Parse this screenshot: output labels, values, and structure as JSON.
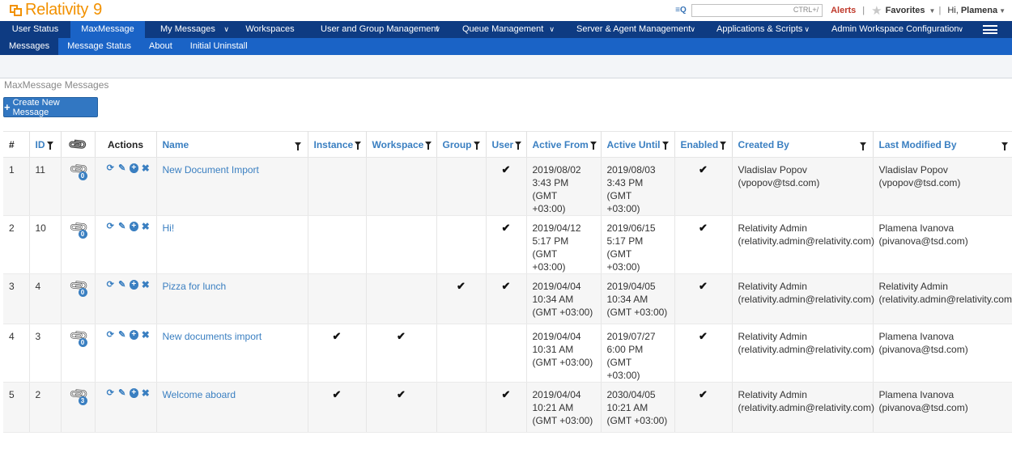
{
  "header": {
    "logo_text": "Relativity",
    "logo_version": "9",
    "search_shortcut": "CTRL+/",
    "alerts": "Alerts",
    "favorites": "Favorites",
    "greeting": "Hi,",
    "user": "Plamena"
  },
  "main_nav": [
    {
      "label": "User Status"
    },
    {
      "label": "MaxMessage"
    },
    {
      "label": "My Messages"
    },
    {
      "label": "Workspaces"
    },
    {
      "label": "User and Group Management"
    },
    {
      "label": "Queue Management"
    },
    {
      "label": "Server & Agent Management"
    },
    {
      "label": "Applications & Scripts"
    },
    {
      "label": "Admin Workspace Configuration"
    }
  ],
  "sub_nav": [
    {
      "label": "Messages"
    },
    {
      "label": "Message Status"
    },
    {
      "label": "About"
    },
    {
      "label": "Initial Uninstall"
    }
  ],
  "page_title": "MaxMessage Messages",
  "create_button": "Create New Message",
  "table": {
    "headers": {
      "num": "#",
      "id": "ID",
      "actions": "Actions",
      "name": "Name",
      "instance": "Instance",
      "workspace": "Workspace",
      "group": "Group",
      "user": "User",
      "active_from": "Active From",
      "active_until": "Active Until",
      "enabled": "Enabled",
      "created_by": "Created By",
      "last_modified_by": "Last Modified By"
    },
    "rows": [
      {
        "num": "1",
        "id": "11",
        "attachments": "0",
        "name": "New Document Import",
        "instance": false,
        "workspace": false,
        "group": false,
        "user": true,
        "active_from_1": "2019/08/02",
        "active_from_2": "3:43 PM (GMT",
        "active_from_3": "+03:00)",
        "active_until_1": "2019/08/03",
        "active_until_2": "3:43 PM (GMT",
        "active_until_3": "+03:00)",
        "enabled": true,
        "created_name": "Vladislav Popov",
        "created_email": "(vpopov@tsd.com)",
        "modified_name": "Vladislav Popov",
        "modified_email": "(vpopov@tsd.com)"
      },
      {
        "num": "2",
        "id": "10",
        "attachments": "0",
        "name": "Hi!",
        "instance": false,
        "workspace": false,
        "group": false,
        "user": true,
        "active_from_1": "2019/04/12",
        "active_from_2": "5:17 PM (GMT",
        "active_from_3": "+03:00)",
        "active_until_1": "2019/06/15",
        "active_until_2": "5:17 PM (GMT",
        "active_until_3": "+03:00)",
        "enabled": true,
        "created_name": "Relativity Admin",
        "created_email": "(relativity.admin@relativity.com)",
        "modified_name": "Plamena Ivanova",
        "modified_email": "(pivanova@tsd.com)"
      },
      {
        "num": "3",
        "id": "4",
        "attachments": "0",
        "name": "Pizza for lunch",
        "instance": false,
        "workspace": false,
        "group": true,
        "user": true,
        "active_from_1": "2019/04/04",
        "active_from_2": "10:34 AM",
        "active_from_3": "(GMT +03:00)",
        "active_until_1": "2019/04/05",
        "active_until_2": "10:34 AM",
        "active_until_3": "(GMT +03:00)",
        "enabled": true,
        "created_name": "Relativity Admin",
        "created_email": "(relativity.admin@relativity.com)",
        "modified_name": "Relativity Admin",
        "modified_email": "(relativity.admin@relativity.com)"
      },
      {
        "num": "4",
        "id": "3",
        "attachments": "0",
        "name": "New documents import",
        "instance": true,
        "workspace": true,
        "group": false,
        "user": false,
        "active_from_1": "2019/04/04",
        "active_from_2": "10:31 AM",
        "active_from_3": "(GMT +03:00)",
        "active_until_1": "2019/07/27",
        "active_until_2": "6:00 PM (GMT",
        "active_until_3": "+03:00)",
        "enabled": true,
        "created_name": "Relativity Admin",
        "created_email": "(relativity.admin@relativity.com)",
        "modified_name": "Plamena Ivanova",
        "modified_email": "(pivanova@tsd.com)"
      },
      {
        "num": "5",
        "id": "2",
        "attachments": "3",
        "name": "Welcome aboard",
        "instance": true,
        "workspace": true,
        "group": false,
        "user": true,
        "active_from_1": "2019/04/04",
        "active_from_2": "10:21 AM",
        "active_from_3": "(GMT +03:00)",
        "active_until_1": "2030/04/05",
        "active_until_2": "10:21 AM",
        "active_until_3": "(GMT +03:00)",
        "enabled": true,
        "created_name": "Relativity Admin",
        "created_email": "(relativity.admin@relativity.com)",
        "modified_name": "Plamena Ivanova",
        "modified_email": "(pivanova@tsd.com)"
      }
    ]
  }
}
